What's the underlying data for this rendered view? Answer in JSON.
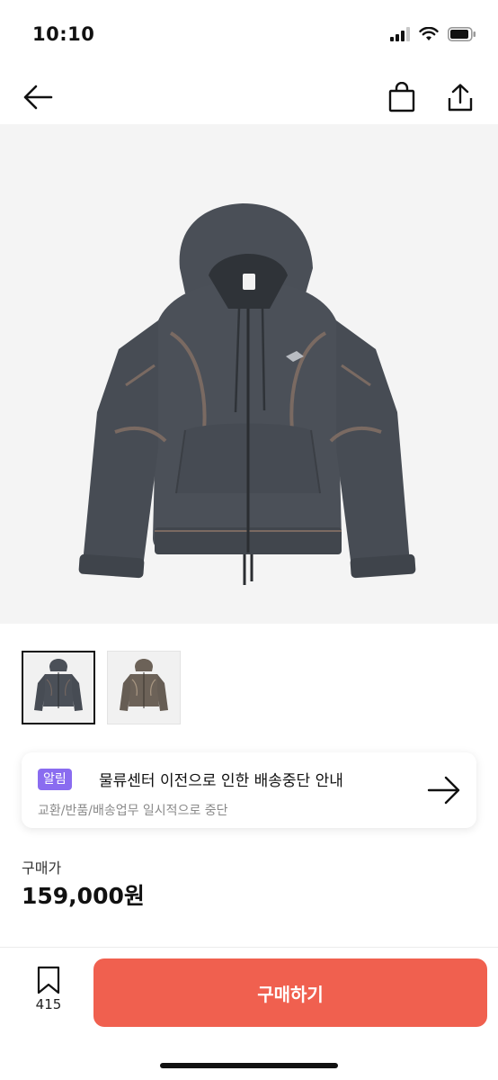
{
  "status_bar": {
    "time": "10:10"
  },
  "nav": {
    "back_icon": "arrow-left-icon",
    "bag_icon": "shopping-bag-icon",
    "share_icon": "share-icon"
  },
  "product": {
    "image_icon": "hoodie-image",
    "thumbnails": [
      {
        "name": "thumbnail-charcoal",
        "color": "#4b5058",
        "stripe": "#7a6a62",
        "active": true
      },
      {
        "name": "thumbnail-brown",
        "color": "#6c6258",
        "stripe": "#a89682",
        "active": false
      }
    ]
  },
  "notice": {
    "badge": "알림",
    "title": "물류센터 이전으로 인한 배송중단 안내",
    "subtitle": "교환/반품/배송업무 일시적으로 중단"
  },
  "price": {
    "label": "구매가",
    "value": "159,000원"
  },
  "bottom_bar": {
    "bookmark_count": "415",
    "buy_label": "구매하기"
  },
  "colors": {
    "buy_button": "#f0604f",
    "badge": "#8a6cf0",
    "hero_bg": "#f4f4f4"
  }
}
